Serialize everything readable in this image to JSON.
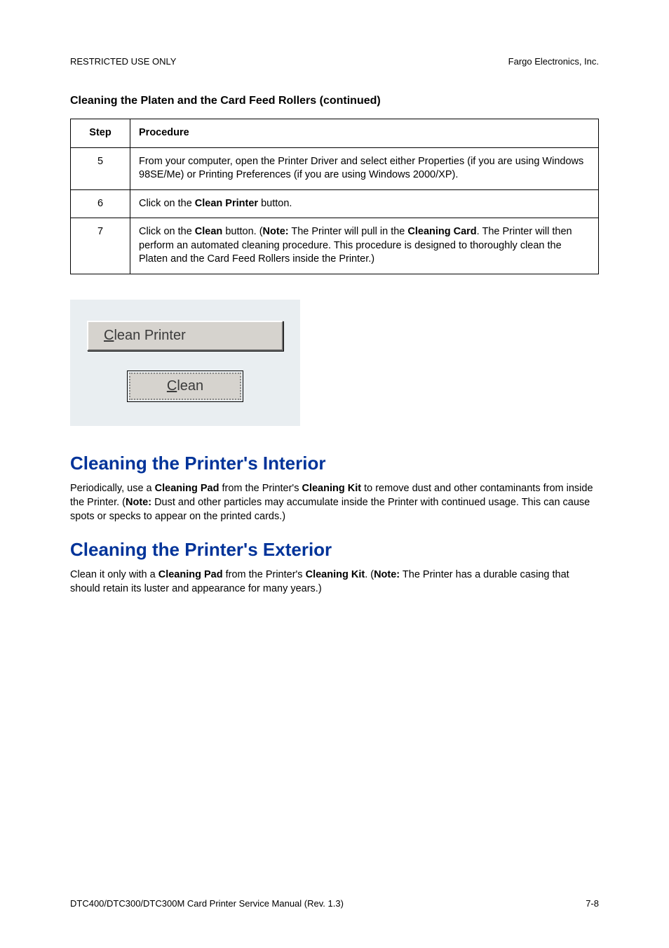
{
  "header": {
    "left": "RESTRICTED USE ONLY",
    "right": "Fargo Electronics, Inc."
  },
  "section_title": "Cleaning the Platen and the Card Feed Rollers (continued)",
  "table": {
    "headers": {
      "step": "Step",
      "procedure": "Procedure"
    },
    "rows": [
      {
        "step": "5",
        "text": "From your computer, open the Printer Driver and select either Properties (if you are using Windows 98SE/Me) or Printing Preferences (if you are using Windows 2000/XP)."
      },
      {
        "step": "6",
        "pre": "Click on the ",
        "bold1": "Clean Printer",
        "post": " button."
      },
      {
        "step": "7",
        "p1": "Click on the ",
        "b1": "Clean",
        "p2": " button. (",
        "b2": "Note:",
        "p3": "  The Printer will pull in the ",
        "b3": "Cleaning Card",
        "p4": ". The Printer will then perform an automated cleaning procedure. This procedure is designed to thoroughly clean the Platen and the Card Feed Rollers inside the Printer.)"
      }
    ]
  },
  "buttons": {
    "clean_printer_u": "C",
    "clean_printer_rest": "lean Printer",
    "clean_u": "C",
    "clean_rest": "lean"
  },
  "h_interior": "Cleaning the Printer's Interior",
  "p_interior": {
    "p1": "Periodically, use a ",
    "b1": "Cleaning Pad",
    "p2": " from the Printer's ",
    "b2": "Cleaning Kit",
    "p3": " to remove dust and other contaminants from inside the Printer. (",
    "b3": "Note:",
    "p4": "  Dust and other particles may accumulate inside the Printer with continued usage. This can cause spots or specks to appear on the printed cards.)"
  },
  "h_exterior": "Cleaning the Printer's Exterior",
  "p_exterior": {
    "p1": "Clean it only with a ",
    "b1": "Cleaning Pad",
    "p2": " from the Printer's ",
    "b2": "Cleaning Kit",
    "p3": ". (",
    "b3": "Note:",
    "p4": "  The Printer has a durable casing that should retain its luster and appearance for many years.)"
  },
  "footer": {
    "left": "DTC400/DTC300/DTC300M Card Printer Service Manual (Rev. 1.3)",
    "right": "7-8"
  }
}
